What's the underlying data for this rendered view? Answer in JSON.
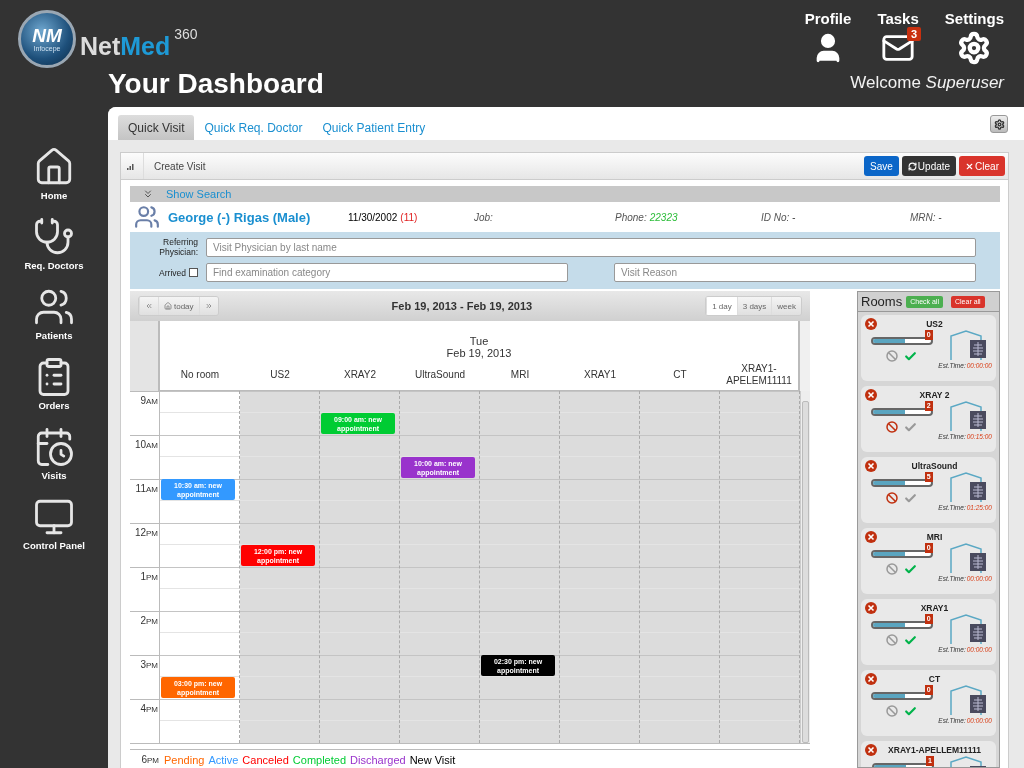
{
  "logo": {
    "initials": "NM",
    "company": "Infocepe",
    "brand_a": "Net",
    "brand_b": "Med",
    "brand_sup": "360"
  },
  "page_title": "Your Dashboard",
  "top_nav": [
    {
      "kind": "profile",
      "label": "Profile"
    },
    {
      "kind": "tasks",
      "label": "Tasks",
      "badge": "3"
    },
    {
      "kind": "settings",
      "label": "Settings"
    }
  ],
  "welcome": "Welcome *Superuser*",
  "sidebar": {
    "items": [
      {
        "kind": "home",
        "label": "Home"
      },
      {
        "kind": "doctor",
        "label": "Req. Doctors"
      },
      {
        "kind": "patients",
        "label": "Patients"
      },
      {
        "kind": "orders",
        "label": "Orders"
      },
      {
        "kind": "visits",
        "label": "Visits"
      },
      {
        "kind": "control",
        "label": "Control Panel"
      }
    ]
  },
  "tabs": [
    {
      "label": "Quick Visit",
      "selected": true
    },
    {
      "label": "Quick Req. Doctor",
      "selected": false
    },
    {
      "label": "Quick Patient Entry",
      "selected": false
    }
  ],
  "form_panel": {
    "title": "Create Visit",
    "show_search": "Show Search",
    "buttons": [
      {
        "kind": "save",
        "label": "Save"
      },
      {
        "kind": "update",
        "label": "Update"
      },
      {
        "kind": "clear",
        "label": "Clear"
      }
    ]
  },
  "patient": {
    "name": "George (-) Rigas (Male)",
    "dob": "11/30/2002",
    "age": "(11)",
    "job_label": "Job:",
    "phone_label": "Phone:",
    "phone": "22323",
    "id_no": "ID No: -",
    "mrn": "MRN: -"
  },
  "visit_form": {
    "referring_label": "Referring Physician:",
    "referring_placeholder": "Visit Physician by last name",
    "arrived_label": "Arrived",
    "arrived": false,
    "category_placeholder": "Find examination category",
    "reason_placeholder": "Visit Reason"
  },
  "calendar": {
    "range": "Feb 19, 2013 - Feb 19, 2013",
    "today": "today",
    "views": [
      {
        "label": "1 day",
        "selected": true
      },
      {
        "label": "3 days",
        "selected": false
      },
      {
        "label": "week",
        "selected": false
      }
    ],
    "day": "Tue",
    "date": "Feb 19, 2013",
    "columns": [
      {
        "name": "No room",
        "available": true,
        "events": [
          {
            "text": "10:30 am: new appointment",
            "color": "#3399ff"
          },
          {
            "text": "03:00 pm: new appointment",
            "color": "#ff6600"
          }
        ]
      },
      {
        "name": "US2",
        "available": false,
        "events": [
          {
            "text": "12:00 pm: new appointment",
            "color": "#ff0000"
          }
        ]
      },
      {
        "name": "XRAY2",
        "available": false,
        "events": [
          {
            "text": "09:00 am: new appointment",
            "color": "#00cc33"
          }
        ]
      },
      {
        "name": "UltraSound",
        "available": false,
        "events": [
          {
            "text": "10:00 am: new appointment",
            "color": "#9933cc"
          }
        ]
      },
      {
        "name": "MRI",
        "available": false,
        "events": [
          {
            "text": "02:30 pm: new appointment",
            "color": "#000000"
          }
        ]
      },
      {
        "name": "XRAY1",
        "available": false
      },
      {
        "name": "CT",
        "available": false
      },
      {
        "name": "XRAY1-APELEM11111",
        "available": false
      }
    ],
    "hours": [
      {
        "label": "9",
        "period": "AM"
      },
      {
        "label": "10",
        "period": "AM"
      },
      {
        "label": "11",
        "period": "AM"
      },
      {
        "label": "12",
        "period": "PM"
      },
      {
        "label": "1",
        "period": "PM"
      },
      {
        "label": "2",
        "period": "PM"
      },
      {
        "label": "3",
        "period": "PM"
      },
      {
        "label": "4",
        "period": "PM"
      }
    ],
    "legend_hour": {
      "label": "6",
      "period": "PM"
    },
    "legend": [
      {
        "label": "Pending",
        "color": "#ff6600"
      },
      {
        "label": "Active",
        "color": "#3399ff"
      },
      {
        "label": "Canceled",
        "color": "#ff0000"
      },
      {
        "label": "Completed",
        "color": "#00cc33"
      },
      {
        "label": "Discharged",
        "color": "#9933cc"
      },
      {
        "label": "New Visit",
        "color": "#000000"
      }
    ]
  },
  "rooms": {
    "title": "Rooms",
    "check_all": "Check all",
    "clear_all": "Clear all",
    "items": [
      {
        "name": "US2",
        "count": "0",
        "level": 0.55,
        "blocked": false,
        "est_label": "Est.Time:",
        "est_time": "00:00:00"
      },
      {
        "name": "XRAY 2",
        "count": "2",
        "level": 0.55,
        "blocked": true,
        "est_label": "Est.Time:",
        "est_time": "00:15:00"
      },
      {
        "name": "UltraSound",
        "count": "5",
        "level": 0.55,
        "blocked": true,
        "est_label": "Est.Time:",
        "est_time": "01:25:00"
      },
      {
        "name": "MRI",
        "count": "0",
        "level": 0.55,
        "blocked": false,
        "est_label": "Est.Time:",
        "est_time": "00:00:00"
      },
      {
        "name": "XRAY1",
        "count": "0",
        "level": 0.55,
        "blocked": false,
        "est_label": "Est.Time:",
        "est_time": "00:00:00"
      },
      {
        "name": "CT",
        "count": "0",
        "level": 0.55,
        "blocked": false,
        "est_label": "Est.Time:",
        "est_time": "00:00:00"
      },
      {
        "name": "XRAY1-APELLEM11111",
        "count": "1",
        "level": 0.55
      }
    ]
  }
}
